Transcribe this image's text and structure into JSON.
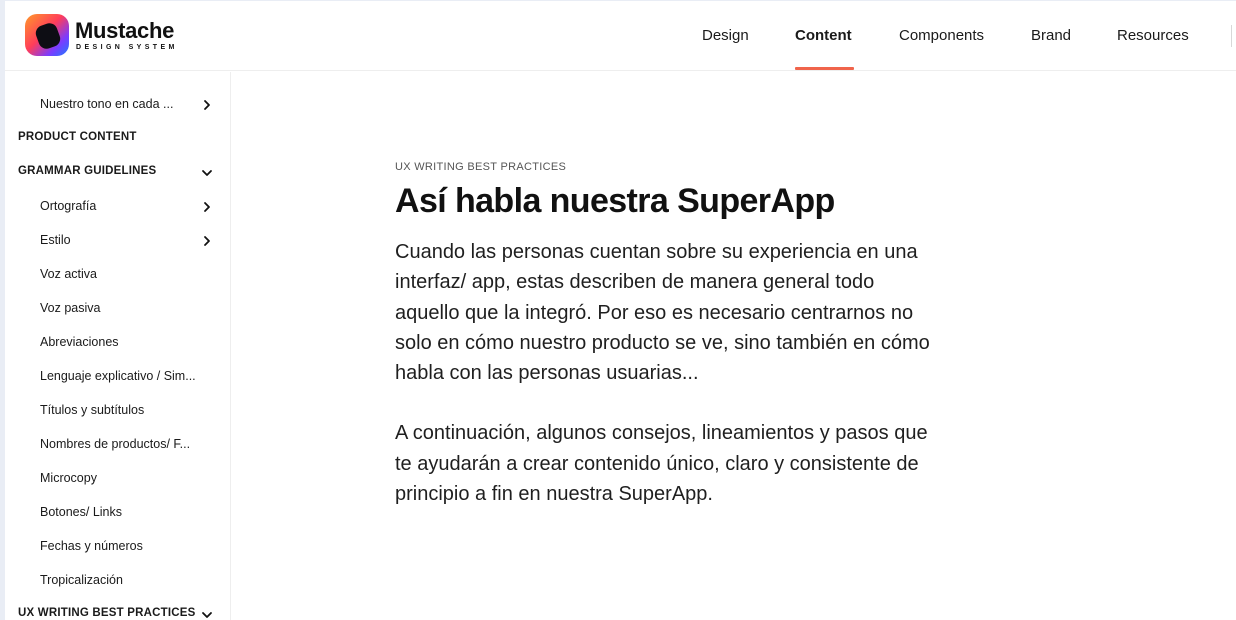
{
  "logo": {
    "title": "Mustache",
    "subtitle": "DESIGN SYSTEM"
  },
  "nav": {
    "tabs": [
      {
        "label": "Design",
        "active": false
      },
      {
        "label": "Content",
        "active": true
      },
      {
        "label": "Components",
        "active": false
      },
      {
        "label": "Brand",
        "active": false
      },
      {
        "label": "Resources",
        "active": false
      }
    ],
    "accent_color": "#f0644b"
  },
  "sidebar": {
    "items": [
      {
        "label": "Nuestro tono en cada ...",
        "icon": "chevron-right-icon"
      },
      {
        "label": "PRODUCT CONTENT",
        "icon": ""
      },
      {
        "label": "GRAMMAR GUIDELINES",
        "icon": "chevron-down-icon"
      },
      {
        "label": "Ortografía",
        "icon": "chevron-right-icon"
      },
      {
        "label": "Estilo",
        "icon": "chevron-right-icon"
      },
      {
        "label": "Voz activa",
        "icon": ""
      },
      {
        "label": "Voz pasiva",
        "icon": ""
      },
      {
        "label": "Abreviaciones",
        "icon": ""
      },
      {
        "label": "Lenguaje explicativo / Sim...",
        "icon": ""
      },
      {
        "label": "Títulos y subtítulos",
        "icon": ""
      },
      {
        "label": "Nombres de productos/ F...",
        "icon": ""
      },
      {
        "label": "Microcopy",
        "icon": ""
      },
      {
        "label": "Botones/ Links",
        "icon": ""
      },
      {
        "label": "Fechas y números",
        "icon": ""
      },
      {
        "label": "Tropicalización",
        "icon": ""
      },
      {
        "label": "UX WRITING BEST PRACTICES",
        "icon": "chevron-down-icon"
      }
    ]
  },
  "content": {
    "eyebrow": "UX WRITING BEST PRACTICES",
    "title": "Así habla nuestra SuperApp",
    "paragraph1": "Cuando las personas cuentan sobre su experiencia en una interfaz/ app, estas describen de manera general todo aquello que la integró. Por eso es necesario centrarnos no solo en cómo nuestro producto se ve, sino también en cómo habla con las personas usuarias...",
    "paragraph2": "A continuación, algunos consejos, lineamientos y pasos que te ayudarán a crear contenido único, claro y consistente de principio a fin en nuestra SuperApp."
  }
}
